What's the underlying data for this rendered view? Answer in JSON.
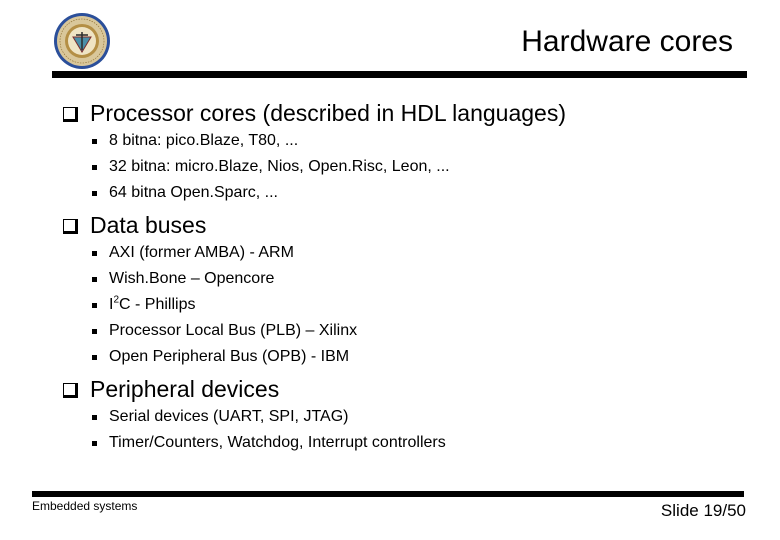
{
  "header": {
    "title": "Hardware cores",
    "logo": "university-seal-logo"
  },
  "sections": [
    {
      "label": "Processor cores (described in HDL languages)",
      "icon": "square-bullet-icon",
      "items": [
        "8 bitna: pico.Blaze, T80, ...",
        "32 bitna: micro.Blaze, Nios, Open.Risc, Leon, ...",
        "64 bitna Open.Sparc, ..."
      ]
    },
    {
      "label": "Data buses",
      "icon": "square-bullet-icon",
      "items": [
        "AXI (former AMBA) - ARM",
        "Wish.Bone – Opencore",
        "I2C - Phillips",
        "Processor Local Bus (PLB) – Xilinx",
        "Open Peripheral Bus (OPB) - IBM"
      ],
      "i2c": {
        "prefix": "I",
        "sup": "2",
        "suffix": "C - Phillips"
      }
    },
    {
      "label": "Peripheral devices",
      "icon": "square-bullet-icon",
      "items": [
        "Serial devices (UART, SPI, JTAG)",
        "Timer/Counters, Watchdog, Interrupt controllers"
      ]
    }
  ],
  "footer": {
    "course": "Embedded systems",
    "slide_number": "Slide 19/50"
  }
}
